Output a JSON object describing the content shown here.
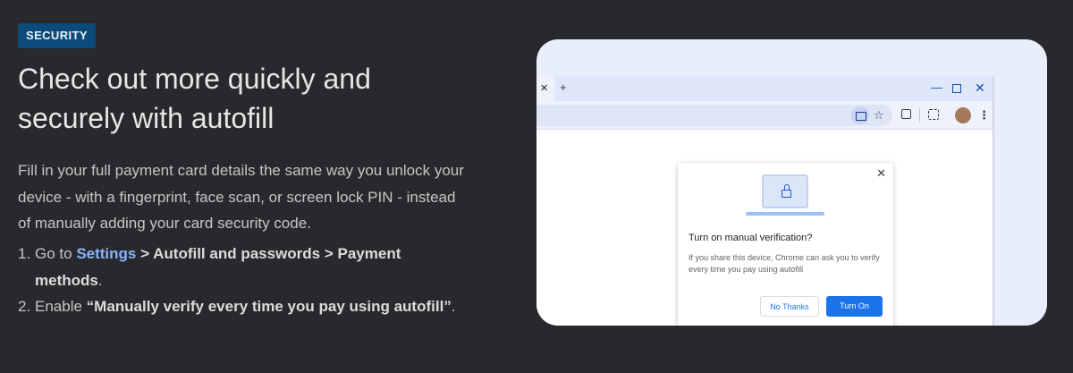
{
  "badge": "SECURITY",
  "headline": "Check out more quickly and securely with autofill",
  "description": "Fill in your full payment card details the same way you unlock your device - with a fingerprint, face scan, or screen lock PIN - instead of manually adding your card security code.",
  "steps": [
    {
      "number": "1.",
      "prefix": "Go to ",
      "settings_link": "Settings",
      "path": " > Autofill and passwords > Payment methods",
      "suffix": "."
    },
    {
      "number": "2.",
      "prefix": "Enable ",
      "bold": "“Manually verify every time you pay using autofill”",
      "suffix": "."
    }
  ],
  "browser": {
    "tab_close_glyph": "✕",
    "new_tab_glyph": "+",
    "minimize_glyph": "—",
    "close_glyph": "✕",
    "bookmark_star_glyph": "☆",
    "menu_glyph": "⋮",
    "icons": [
      "payment-card-icon",
      "bookmark-star-icon",
      "extensions-icon",
      "lens-icon",
      "profile-avatar",
      "more-menu-icon"
    ]
  },
  "dialog": {
    "close_glyph": "✕",
    "title": "Turn on manual verification?",
    "body": "If you share this device, Chrome can ask you to verify every time you pay using autofill",
    "secondary_button": "No Thanks",
    "primary_button": "Turn On"
  },
  "colors": {
    "page_background": "#28292c",
    "badge_background": "#0b4a79",
    "link": "#8ab4f8",
    "primary_button": "#1a73e8",
    "panel_background": "#e9eefc"
  }
}
